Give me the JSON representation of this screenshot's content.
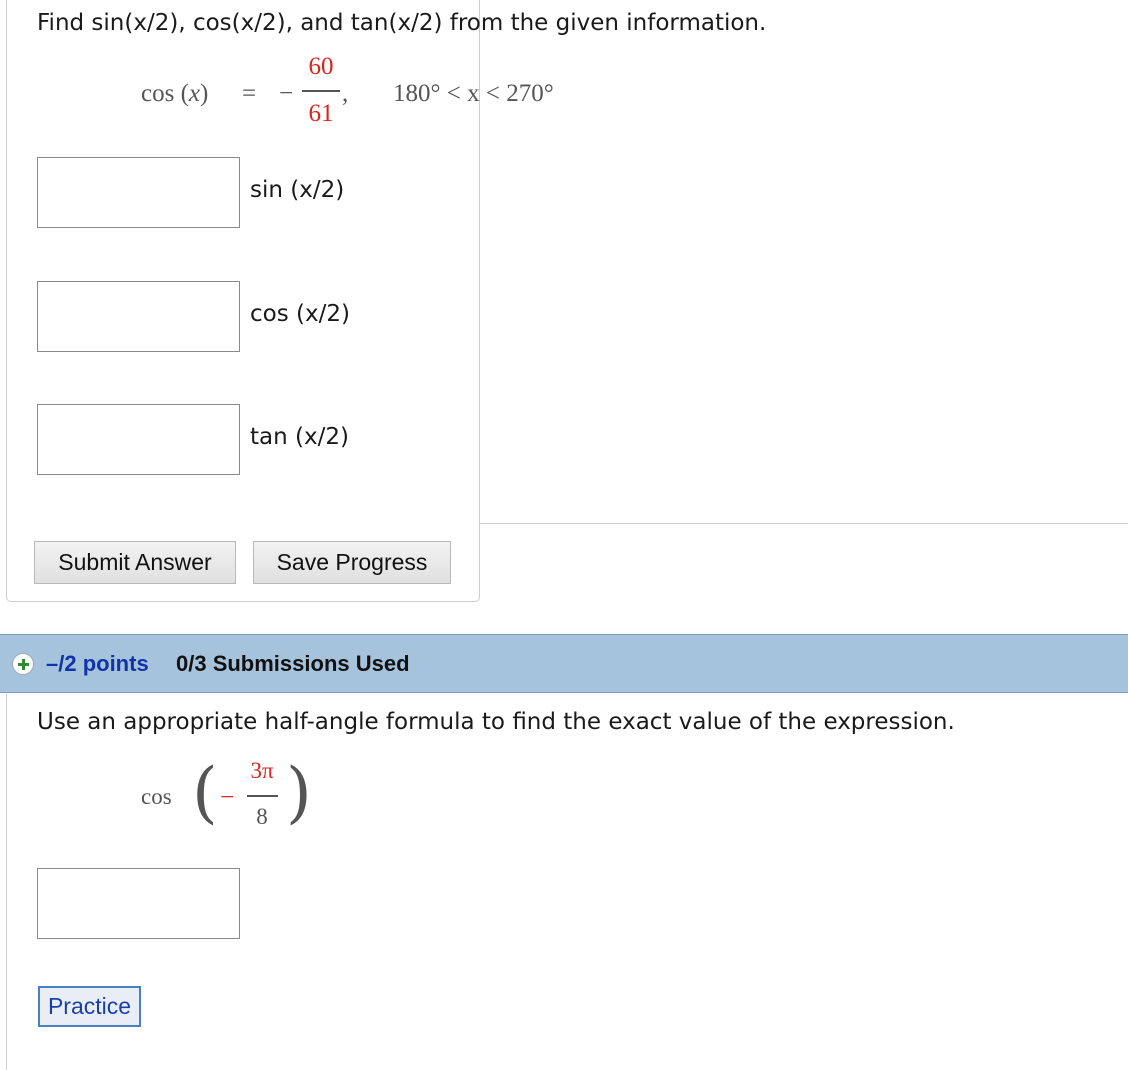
{
  "question1": {
    "prompt": "Find sin(x/2), cos(x/2), and tan(x/2) from the given information.",
    "given": {
      "lhs": "cos",
      "variable": "x",
      "equals": "=",
      "minus": "−",
      "numerator": "60",
      "denominator": "61",
      "comma": ",",
      "range": "180° < x < 270°"
    },
    "answers": [
      {
        "label": "sin (x/2)",
        "value": ""
      },
      {
        "label": "cos (x/2)",
        "value": ""
      },
      {
        "label": "tan (x/2)",
        "value": ""
      }
    ],
    "buttons": {
      "submit": "Submit Answer",
      "save": "Save Progress"
    }
  },
  "question2": {
    "points": "–/2 points",
    "submissions": "0/3 Submissions Used",
    "prompt": "Use an appropriate half-angle formula to find the exact value of the expression.",
    "expression": {
      "func": "cos",
      "minus": "−",
      "numerator": "3π",
      "denominator": "8"
    },
    "answer_value": "",
    "practice_label": "Practice"
  },
  "colors": {
    "fraction_red": "#d9261c",
    "header_blue": "#a5c3dd",
    "points_blue": "#1133aa",
    "plus_green": "#2e8b2e"
  }
}
